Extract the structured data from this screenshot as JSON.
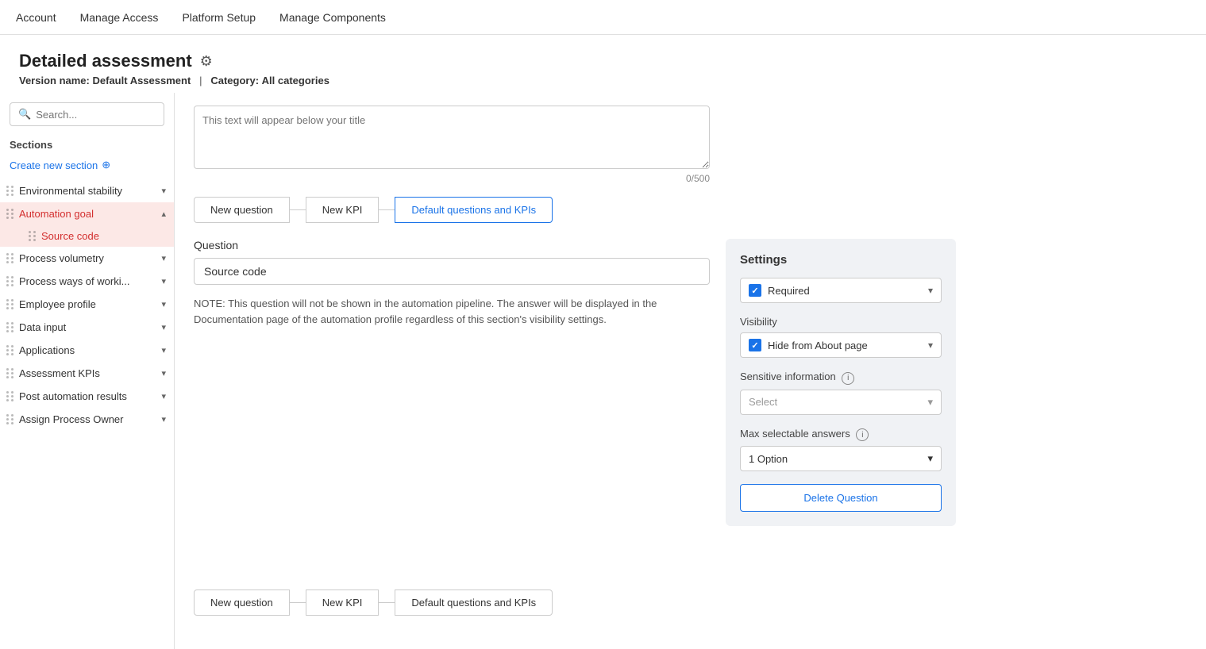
{
  "nav": {
    "items": [
      "Account",
      "Manage Access",
      "Platform Setup",
      "Manage Components"
    ]
  },
  "header": {
    "title": "Detailed assessment",
    "version_label": "Version name:",
    "version_value": "Default Assessment",
    "category_label": "Category:",
    "category_value": "All categories"
  },
  "sidebar": {
    "search_placeholder": "Search...",
    "sections_label": "Sections",
    "create_section": "Create new section",
    "items": [
      {
        "label": "Environmental stability",
        "expanded": false,
        "active": false
      },
      {
        "label": "Automation goal",
        "expanded": true,
        "active": false
      },
      {
        "label": "Source code",
        "sub": true,
        "active": true
      },
      {
        "label": "Process volumetry",
        "expanded": false,
        "active": false
      },
      {
        "label": "Process ways of worki...",
        "expanded": false,
        "active": false
      },
      {
        "label": "Employee profile",
        "expanded": false,
        "active": false
      },
      {
        "label": "Data input",
        "expanded": false,
        "active": false
      },
      {
        "label": "Applications",
        "expanded": false,
        "active": false
      },
      {
        "label": "Assessment KPIs",
        "expanded": false,
        "active": false
      },
      {
        "label": "Post automation results",
        "expanded": false,
        "active": false
      },
      {
        "label": "Assign Process Owner",
        "expanded": false,
        "active": false
      }
    ]
  },
  "content": {
    "textarea_placeholder": "This text will appear below your title",
    "char_count": "0/500",
    "tabs": [
      {
        "label": "New question",
        "active": false
      },
      {
        "label": "New KPI",
        "active": false
      },
      {
        "label": "Default questions and KPIs",
        "active": true
      }
    ],
    "question_label": "Question",
    "question_value": "Source code",
    "note": "NOTE: This question will not be shown in the automation pipeline. The answer will be displayed in the Documentation page of the automation profile regardless of this section's visibility settings."
  },
  "settings": {
    "title": "Settings",
    "required_label": "Required",
    "required_value": "Required",
    "visibility_label": "Visibility",
    "visibility_value": "Hide from About page",
    "sensitive_label": "Sensitive information",
    "sensitive_placeholder": "Select",
    "max_answers_label": "Max selectable answers",
    "max_answers_value": "1 Option",
    "delete_btn": "Delete Question"
  },
  "bottom_tabs": [
    {
      "label": "New question"
    },
    {
      "label": "New KPI"
    },
    {
      "label": "Default questions and KPIs"
    }
  ]
}
